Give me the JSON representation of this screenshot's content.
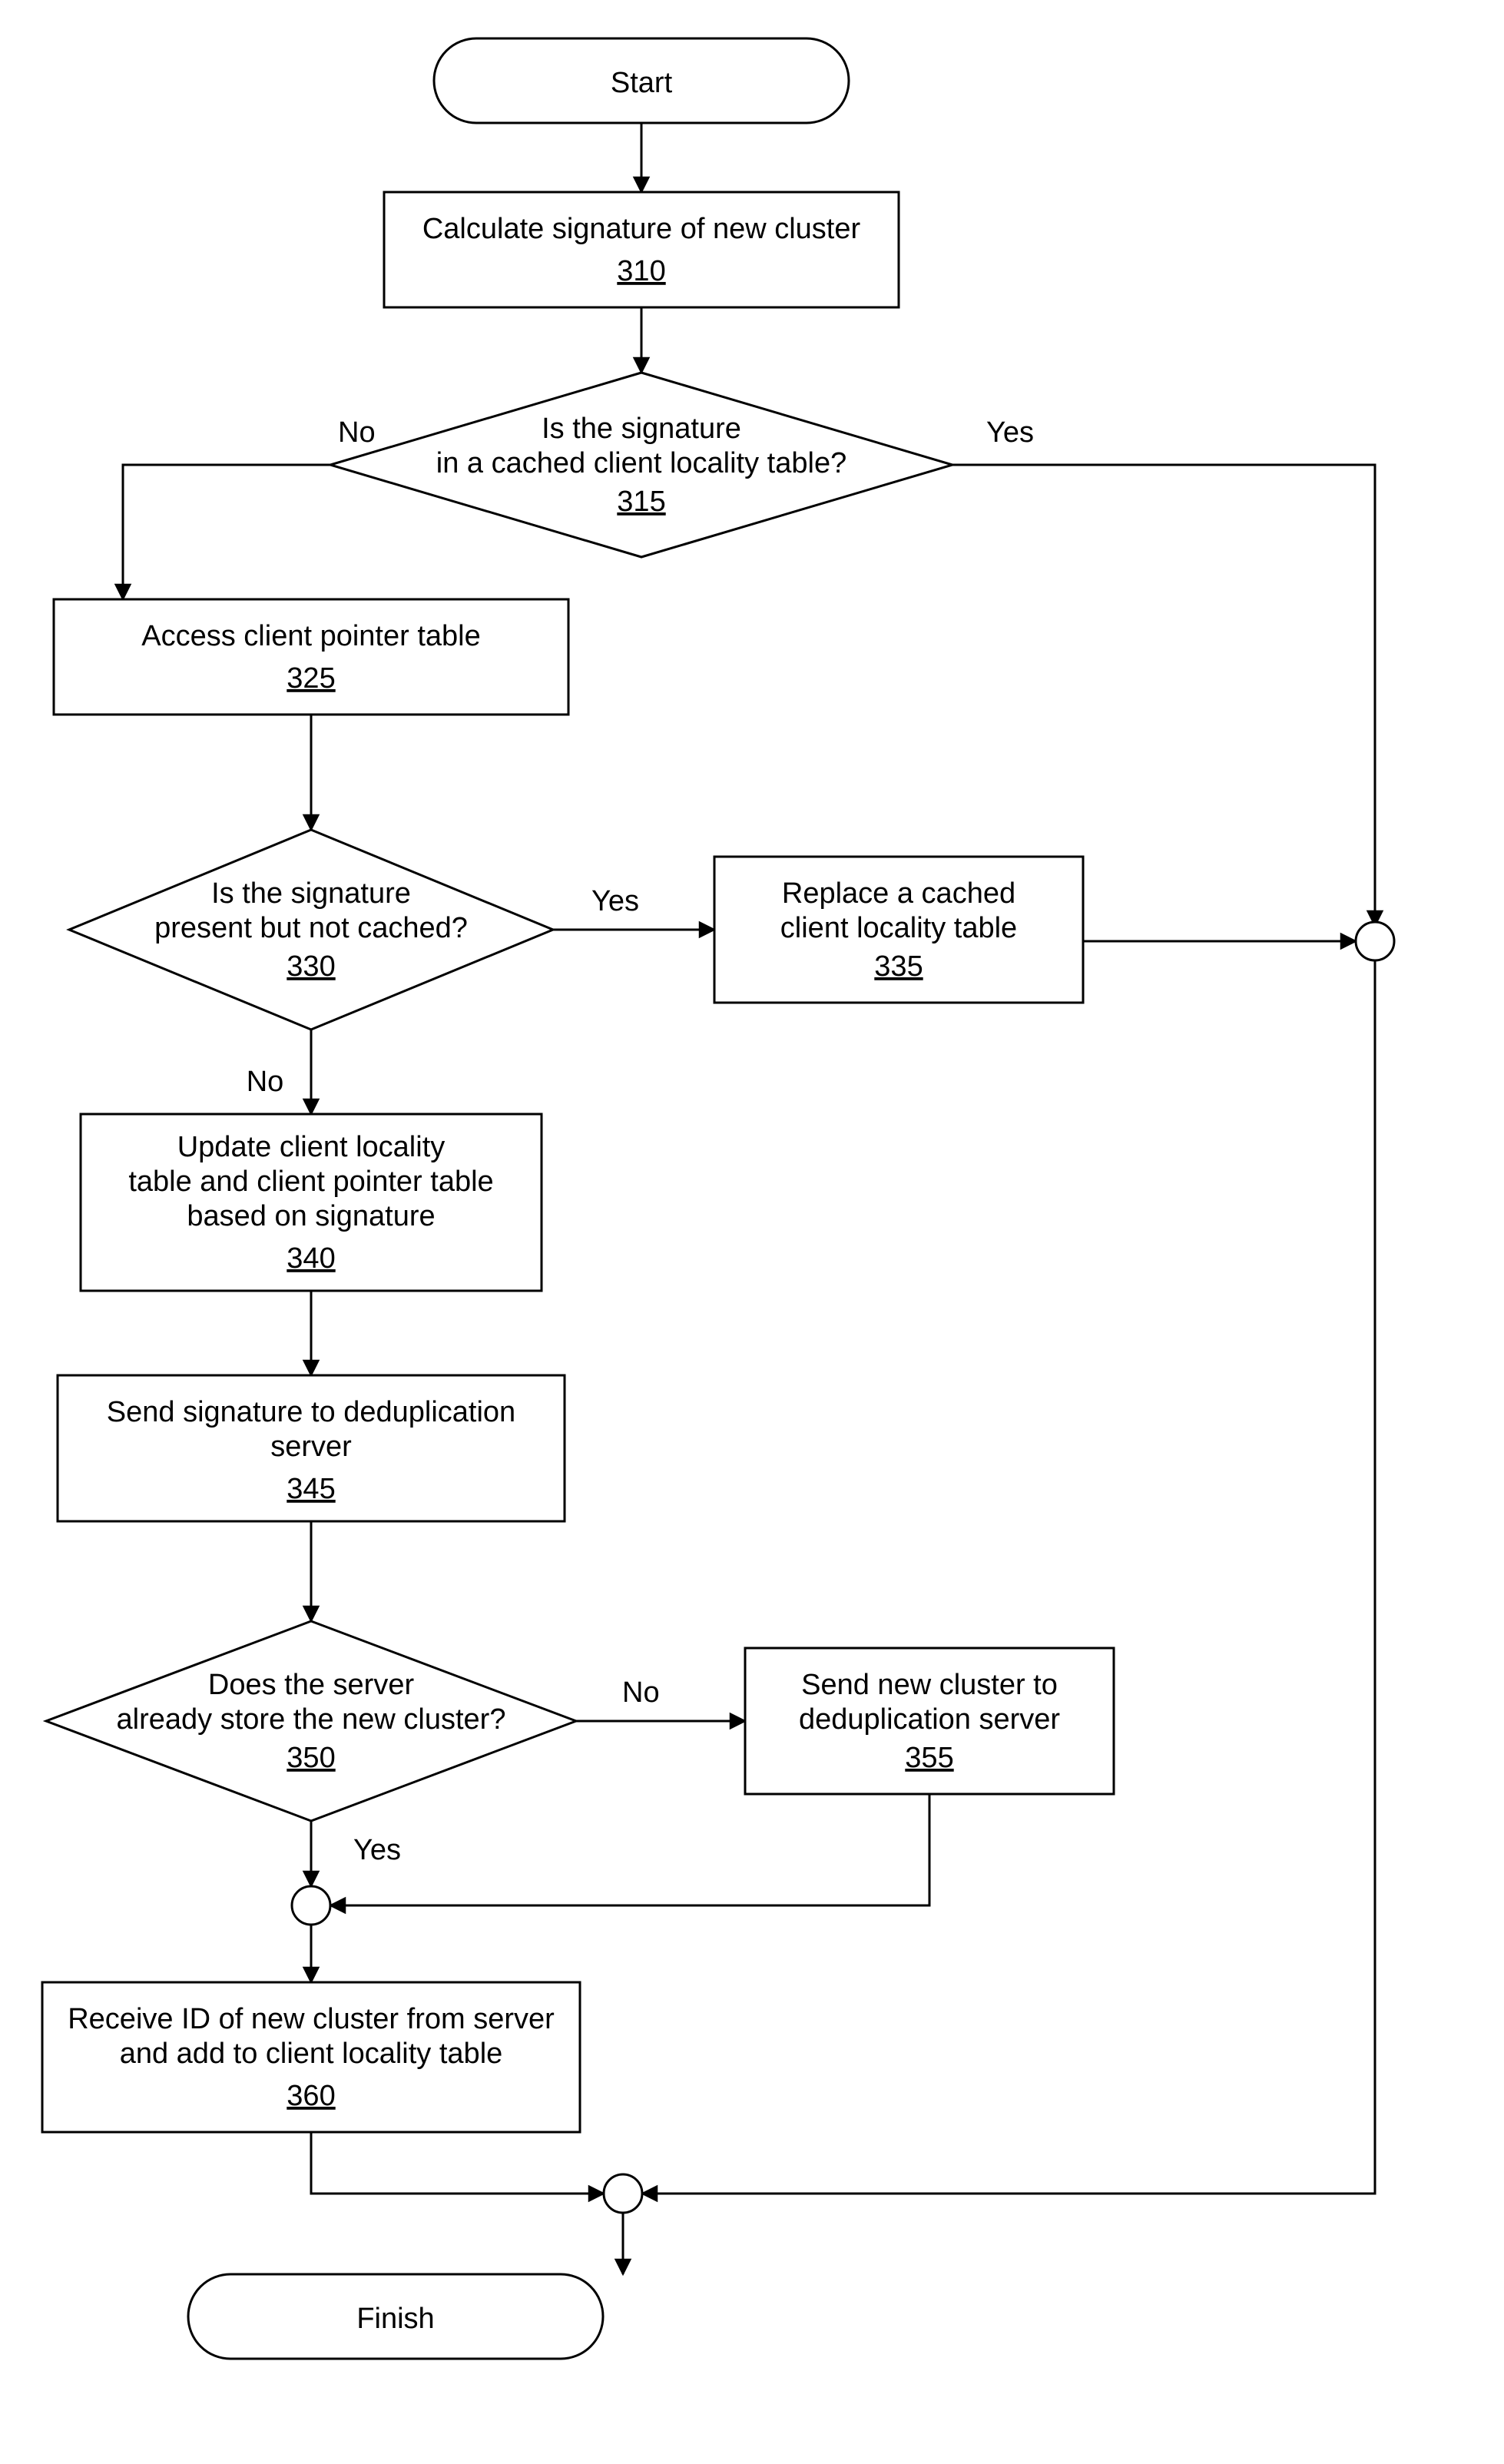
{
  "chart_data": {
    "type": "flowchart",
    "nodes": [
      {
        "id": "start",
        "kind": "terminator",
        "label": "Start"
      },
      {
        "id": "310",
        "kind": "process",
        "label": "Calculate signature of new cluster",
        "ref": "310"
      },
      {
        "id": "315",
        "kind": "decision",
        "label": "Is the signature in a cached client locality table?",
        "ref": "315"
      },
      {
        "id": "325",
        "kind": "process",
        "label": "Access client pointer table",
        "ref": "325"
      },
      {
        "id": "330",
        "kind": "decision",
        "label": "Is the signature present but not cached?",
        "ref": "330"
      },
      {
        "id": "335",
        "kind": "process",
        "label": "Replace a cached client locality table",
        "ref": "335"
      },
      {
        "id": "340",
        "kind": "process",
        "label": "Update client locality table and client pointer table based on signature",
        "ref": "340"
      },
      {
        "id": "345",
        "kind": "process",
        "label": "Send signature to deduplication server",
        "ref": "345"
      },
      {
        "id": "350",
        "kind": "decision",
        "label": "Does the server already store the new cluster?",
        "ref": "350"
      },
      {
        "id": "355",
        "kind": "process",
        "label": "Send new cluster to deduplication server",
        "ref": "355"
      },
      {
        "id": "360",
        "kind": "process",
        "label": "Receive ID of new cluster from server and add to client locality table",
        "ref": "360"
      },
      {
        "id": "finish",
        "kind": "terminator",
        "label": "Finish"
      }
    ],
    "edges": [
      {
        "from": "start",
        "to": "310"
      },
      {
        "from": "310",
        "to": "315"
      },
      {
        "from": "315",
        "to": "325",
        "label": "No"
      },
      {
        "from": "315",
        "to": "j2",
        "label": "Yes"
      },
      {
        "from": "325",
        "to": "330"
      },
      {
        "from": "330",
        "to": "335",
        "label": "Yes"
      },
      {
        "from": "335",
        "to": "j2"
      },
      {
        "from": "330",
        "to": "340",
        "label": "No"
      },
      {
        "from": "340",
        "to": "345"
      },
      {
        "from": "345",
        "to": "350"
      },
      {
        "from": "350",
        "to": "355",
        "label": "No"
      },
      {
        "from": "350",
        "to": "j1",
        "label": "Yes"
      },
      {
        "from": "355",
        "to": "j1"
      },
      {
        "from": "j1",
        "to": "360"
      },
      {
        "from": "360",
        "to": "j2"
      },
      {
        "from": "j2",
        "to": "finish"
      }
    ]
  },
  "labels": {
    "start": "Start",
    "finish": "Finish",
    "n310": {
      "l1": "Calculate signature of new cluster",
      "ref": "310"
    },
    "n315": {
      "l1": "Is the signature",
      "l2": "in a cached client locality table?",
      "ref": "315"
    },
    "n325": {
      "l1": "Access client pointer table",
      "ref": "325"
    },
    "n330": {
      "l1": "Is the signature",
      "l2": "present but not cached?",
      "ref": "330"
    },
    "n335": {
      "l1": "Replace a cached",
      "l2": "client locality table",
      "ref": "335"
    },
    "n340": {
      "l1": "Update client locality",
      "l2": "table and client pointer table",
      "l3": "based on signature",
      "ref": "340"
    },
    "n345": {
      "l1": "Send signature to deduplication",
      "l2": "server",
      "ref": "345"
    },
    "n350": {
      "l1": "Does the server",
      "l2": "already store the new cluster?",
      "ref": "350"
    },
    "n355": {
      "l1": "Send new cluster to",
      "l2": "deduplication server",
      "ref": "355"
    },
    "n360": {
      "l1": "Receive ID of new cluster from server",
      "l2": "and add to client locality table",
      "ref": "360"
    },
    "yes": "Yes",
    "no": "No"
  }
}
